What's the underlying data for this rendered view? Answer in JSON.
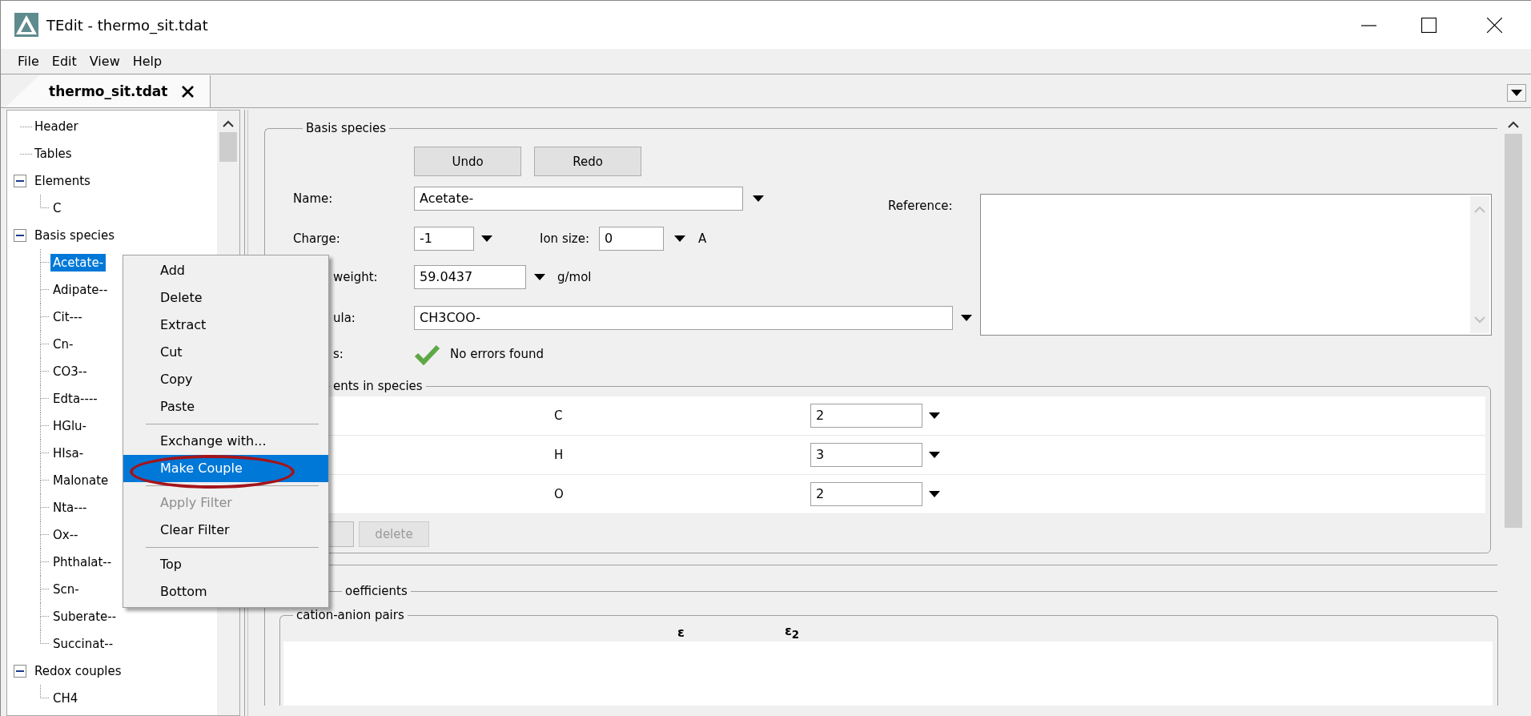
{
  "window": {
    "title": "TEdit - thermo_sit.tdat"
  },
  "menu_bar": [
    "File",
    "Edit",
    "View",
    "Help"
  ],
  "tabs": [
    {
      "label": "thermo_sit.tdat",
      "selected": true
    }
  ],
  "tree": [
    {
      "label": "Header",
      "selected": false
    },
    {
      "label": "Tables",
      "selected": false
    },
    {
      "label": "Elements",
      "selected": false,
      "expanded": true,
      "children": [
        {
          "label": "C",
          "selected": false
        }
      ]
    },
    {
      "label": "Basis species",
      "selected": false,
      "expanded": true,
      "children": [
        {
          "label": "Acetate-",
          "selected": true
        },
        {
          "label": "Adipate--",
          "selected": false
        },
        {
          "label": "Cit---",
          "selected": false
        },
        {
          "label": "Cn-",
          "selected": false
        },
        {
          "label": "CO3--",
          "selected": false
        },
        {
          "label": "Edta----",
          "selected": false
        },
        {
          "label": "HGlu-",
          "selected": false
        },
        {
          "label": "HIsa-",
          "selected": false
        },
        {
          "label": "Malonate",
          "selected": false
        },
        {
          "label": "Nta---",
          "selected": false
        },
        {
          "label": "Ox--",
          "selected": false
        },
        {
          "label": "Phthalat--",
          "selected": false
        },
        {
          "label": "Scn-",
          "selected": false
        },
        {
          "label": "Suberate--",
          "selected": false
        },
        {
          "label": "Succinat--",
          "selected": false
        }
      ]
    },
    {
      "label": "Redox couples",
      "selected": false,
      "expanded": true,
      "children": [
        {
          "label": "CH4",
          "selected": false
        }
      ]
    }
  ],
  "context_menu": [
    {
      "kind": "item",
      "label": "Add",
      "disabled": false,
      "selected": false
    },
    {
      "kind": "item",
      "label": "Delete",
      "disabled": false,
      "selected": false
    },
    {
      "kind": "item",
      "label": "Extract",
      "disabled": false,
      "selected": false
    },
    {
      "kind": "item",
      "label": "Cut",
      "disabled": false,
      "selected": false
    },
    {
      "kind": "item",
      "label": "Copy",
      "disabled": false,
      "selected": false
    },
    {
      "kind": "item",
      "label": "Paste",
      "disabled": false,
      "selected": false
    },
    {
      "kind": "separator"
    },
    {
      "kind": "item",
      "label": "Exchange with...",
      "disabled": false,
      "selected": false
    },
    {
      "kind": "item",
      "label": "Make Couple",
      "disabled": false,
      "selected": true
    },
    {
      "kind": "separator"
    },
    {
      "kind": "item",
      "label": "Apply Filter",
      "disabled": true,
      "selected": false
    },
    {
      "kind": "item",
      "label": "Clear Filter",
      "disabled": false,
      "selected": false
    },
    {
      "kind": "separator"
    },
    {
      "kind": "item",
      "label": "Top",
      "disabled": false,
      "selected": false
    },
    {
      "kind": "item",
      "label": "Bottom",
      "disabled": false,
      "selected": false
    }
  ],
  "basis_species": {
    "title": "Basis species",
    "buttons": [
      "Undo",
      "Redo"
    ],
    "name": {
      "label": "Name:",
      "value": "Acetate-"
    },
    "charge": {
      "label": "Charge:",
      "value": "-1"
    },
    "ion_size": {
      "label": "Ion size:",
      "value": "0",
      "unit": "A"
    },
    "weight": {
      "label": "weight:",
      "value": "59.0437",
      "unit": "g/mol"
    },
    "formula": {
      "label": "ula:",
      "value": "CH3COO-"
    },
    "status": {
      "label": "s:",
      "text": "No errors found",
      "ok": true
    },
    "reference": {
      "label": "Reference:"
    },
    "elements": {
      "title": "ents in species",
      "rows": [
        {
          "element": "C",
          "count": "2"
        },
        {
          "element": "H",
          "count": "3"
        },
        {
          "element": "O",
          "count": "2"
        }
      ],
      "delete_button": {
        "label": "delete",
        "disabled": true
      }
    }
  },
  "coefficients": {
    "title": "oefficients",
    "pairs": {
      "title": "cation-anion pairs",
      "columns": [
        "ε",
        "ε$_{2}$"
      ]
    }
  }
}
